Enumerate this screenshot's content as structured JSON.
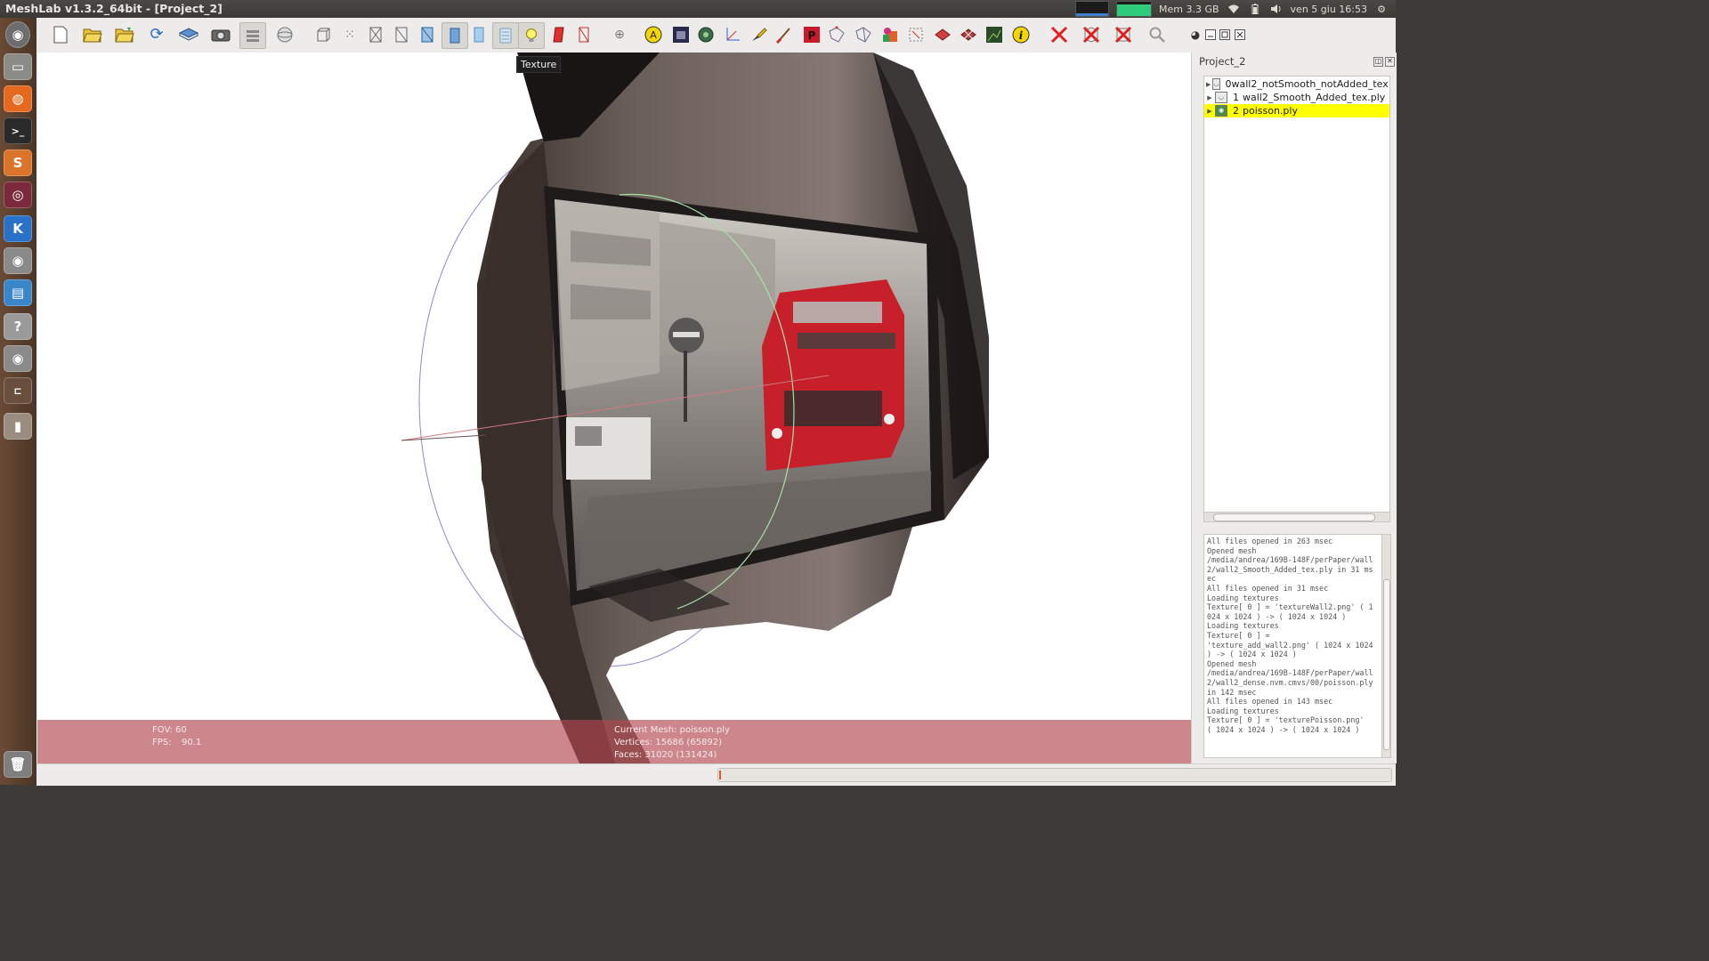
{
  "window": {
    "title": "MeshLab v1.3.2_64bit - [Project_2]"
  },
  "top_panel": {
    "mem": "Mem 3.3 GB",
    "clock": "ven 5 giu 16:53"
  },
  "toolbar": {
    "tooltip": "Texture"
  },
  "viewport": {
    "fov": "FOV: 60",
    "fps_label": "FPS:",
    "fps_value": "90.1",
    "current_mesh": "Current Mesh: poisson.ply",
    "vertices": "Vertices: 15686 (65892)",
    "faces": "Faces: 31020 (131424)"
  },
  "project": {
    "title": "Project_2",
    "layers": [
      {
        "index": "0",
        "name": "wall2_notSmooth_notAdded_tex.",
        "selected": false
      },
      {
        "index": "1",
        "name": "wall2_Smooth_Added_tex.ply",
        "selected": false
      },
      {
        "index": "2",
        "name": "poisson.ply",
        "selected": true
      }
    ]
  },
  "log": "All files opened in 263 msec\nOpened mesh\n/media/andrea/169B-148F/perPaper/wall2/wall2_Smooth_Added_tex.ply in 31 msec\nAll files opened in 31 msec\nLoading textures\nTexture[ 0 ] = 'textureWall2.png' ( 1024 x 1024 ) -> ( 1024 x 1024 )\nLoading textures\nTexture[ 0 ] =\n'texture_add_wall2.png' ( 1024 x 1024 ) -> ( 1024 x 1024 )\nOpened mesh\n/media/andrea/169B-148F/perPaper/wall2/wall2_dense.nvm.cmvs/00/poisson.ply in 142 msec\nAll files opened in 143 msec\nLoading textures\nTexture[ 0 ] = 'texturePoisson.png'\n( 1024 x 1024 ) -> ( 1024 x 1024 )",
  "colors": {
    "info_bar": "#b2464e",
    "selected_layer": "#ffff00",
    "bus_red": "#c8202a"
  },
  "icons": {
    "launcher": [
      "ubuntu-dash-icon",
      "files-icon",
      "firefox-icon",
      "terminal-icon",
      "sublime-text-icon",
      "app-icon",
      "kde-connect-icon",
      "meshlab-eye-icon",
      "libreoffice-icon",
      "help-icon",
      "meshlab-eye-icon",
      "app-icon",
      "usb-drive-icon",
      "trash-icon"
    ]
  }
}
